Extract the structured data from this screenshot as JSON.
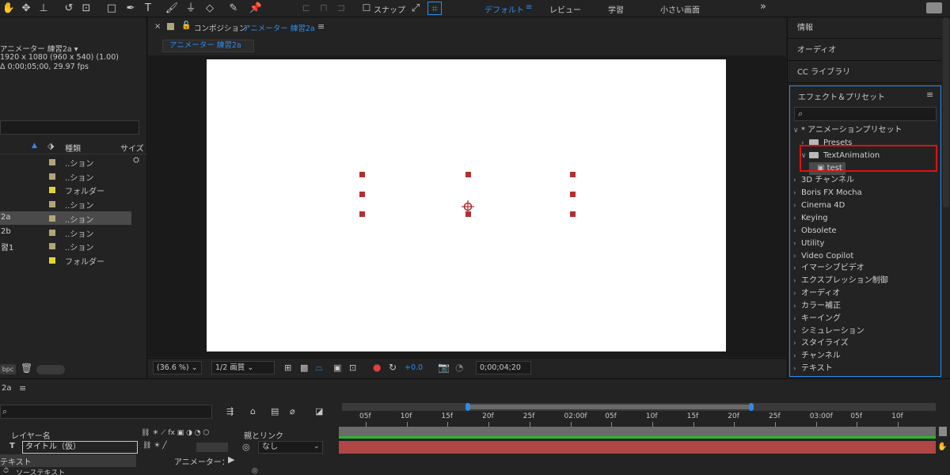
{
  "toolbar": {
    "snap_label": "スナップ",
    "workspaces": [
      "デフォルト",
      "レビュー",
      "学習",
      "小さい画面"
    ],
    "active_workspace": "デフォルト",
    "more": "»"
  },
  "project": {
    "comp_name": "アニメーター 練習2a ▾",
    "comp_size": "1920 x 1080  (960 x 540) (1.00)",
    "comp_duration": "Δ 0;00;05;00, 29.97 fps",
    "col_type": "種類",
    "col_size": "サイズ",
    "items": [
      {
        "name": "",
        "type": "..ション",
        "color": "#b3a47a"
      },
      {
        "name": "",
        "type": "..ション",
        "color": "#b3a47a"
      },
      {
        "name": "",
        "type": "フォルダー",
        "color": "#e3d23a"
      },
      {
        "name": "",
        "type": "..ション",
        "color": "#b3a47a"
      },
      {
        "name": "2a",
        "type": "..ション",
        "color": "#b3a47a"
      },
      {
        "name": "2b",
        "type": "..ション",
        "color": "#b3a47a"
      },
      {
        "name": "習1",
        "type": "..ション",
        "color": "#b3a47a"
      },
      {
        "name": "",
        "type": "フォルダー",
        "color": "#e3d23a"
      }
    ],
    "bpc": "bpc"
  },
  "comp": {
    "tab_prefix": "コンポジション",
    "tab_name": "アニメーター 練習2a",
    "subtab": "アニメーター 練習2a",
    "zoom": "(36.6 %)",
    "resolution": "1/2 画質",
    "exposure": "+0.0",
    "timecode": "0;00;04;20"
  },
  "right": {
    "tabs": [
      "情報",
      "オーディオ",
      "CC ライブラリ"
    ],
    "effects_title": "エフェクト＆プリセット",
    "tree": [
      {
        "label": "* アニメーションプリセット",
        "chev": "∨",
        "indent": 0,
        "folder": false
      },
      {
        "label": "Presets",
        "chev": "›",
        "indent": 1,
        "folder": true
      },
      {
        "label": "TextAnimation",
        "chev": "∨",
        "indent": 1,
        "folder": true
      },
      {
        "label": "test",
        "chev": "",
        "indent": 2,
        "folder": false,
        "preset": true
      },
      {
        "label": "3D チャンネル",
        "chev": "›",
        "indent": 0,
        "folder": false
      },
      {
        "label": "Boris FX Mocha",
        "chev": "›",
        "indent": 0,
        "folder": false
      },
      {
        "label": "Cinema 4D",
        "chev": "›",
        "indent": 0,
        "folder": false
      },
      {
        "label": "Keying",
        "chev": "›",
        "indent": 0,
        "folder": false
      },
      {
        "label": "Obsolete",
        "chev": "›",
        "indent": 0,
        "folder": false
      },
      {
        "label": "Utility",
        "chev": "›",
        "indent": 0,
        "folder": false
      },
      {
        "label": "Video Copilot",
        "chev": "›",
        "indent": 0,
        "folder": false
      },
      {
        "label": "イマーシブビデオ",
        "chev": "›",
        "indent": 0,
        "folder": false
      },
      {
        "label": "エクスプレッション制御",
        "chev": "›",
        "indent": 0,
        "folder": false
      },
      {
        "label": "オーディオ",
        "chev": "›",
        "indent": 0,
        "folder": false
      },
      {
        "label": "カラー補正",
        "chev": "›",
        "indent": 0,
        "folder": false
      },
      {
        "label": "キーイング",
        "chev": "›",
        "indent": 0,
        "folder": false
      },
      {
        "label": "シミュレーション",
        "chev": "›",
        "indent": 0,
        "folder": false
      },
      {
        "label": "スタイライズ",
        "chev": "›",
        "indent": 0,
        "folder": false
      },
      {
        "label": "チャンネル",
        "chev": "›",
        "indent": 0,
        "folder": false
      },
      {
        "label": "テキスト",
        "chev": "›",
        "indent": 0,
        "folder": false
      }
    ]
  },
  "timeline": {
    "tab": "2a",
    "col_layer_name": "レイヤー名",
    "col_parent": "親とリンク",
    "layer_name": "タイトル（仮）",
    "layer_parent": "なし",
    "text_label": "テキスト",
    "animator_label": "アニメーター：",
    "source_text": "ソーステキスト",
    "ruler_labels": [
      "05f",
      "10f",
      "15f",
      "20f",
      "25f",
      "02:00f",
      "05f",
      "10f",
      "15f",
      "20f",
      "25f",
      "03:00f",
      "05f",
      "10f"
    ]
  }
}
